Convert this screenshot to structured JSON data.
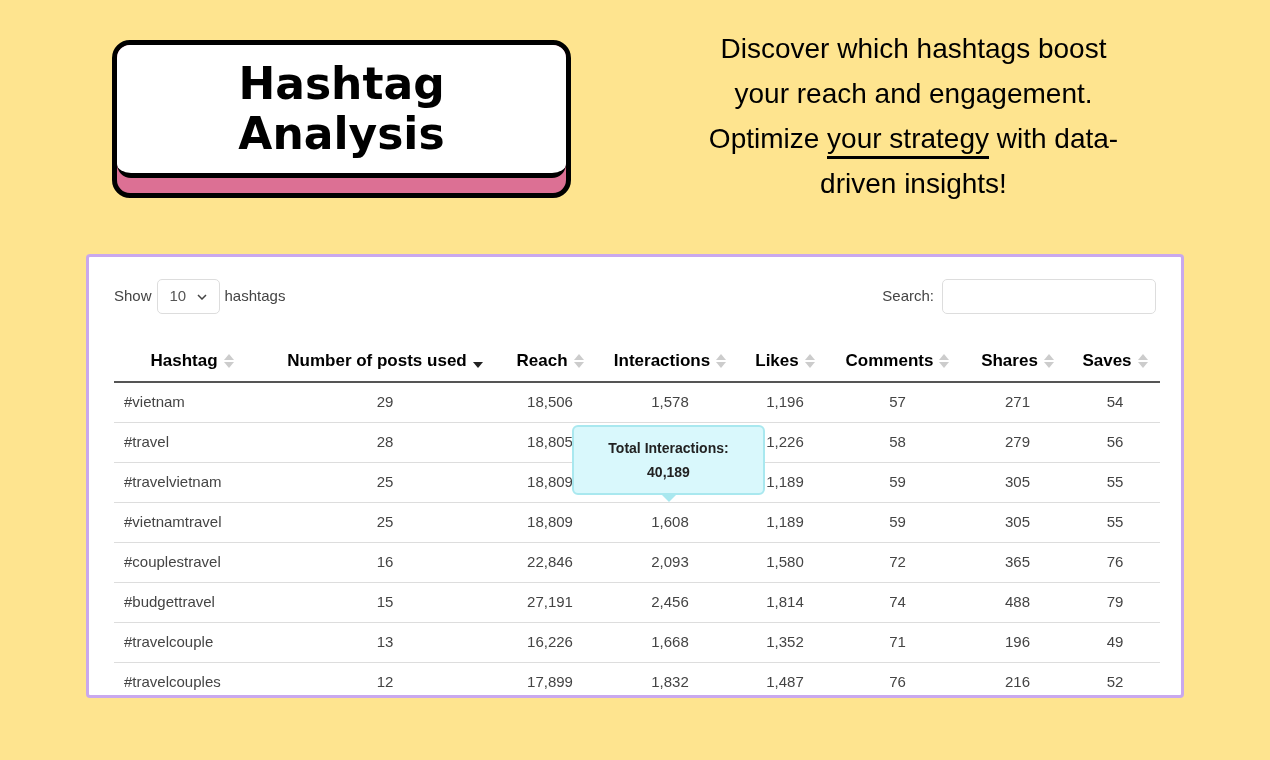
{
  "title": "Hashtag Analysis",
  "tagline": [
    {
      "text": "Discover which hashtags boost your reach and engagement. Optimize ",
      "underlined": false
    },
    {
      "text": "your strategy",
      "underlined": true
    },
    {
      "text": " with data-driven insights!",
      "underlined": false
    }
  ],
  "controls": {
    "show_label": "Show",
    "page_size": "10",
    "show_suffix": "hashtags",
    "search_label": "Search:"
  },
  "table": {
    "columns": [
      {
        "label": "Hashtag",
        "sorted": false
      },
      {
        "label": "Number of posts used",
        "sorted": true
      },
      {
        "label": "Reach",
        "sorted": false
      },
      {
        "label": "Interactions",
        "sorted": false
      },
      {
        "label": "Likes",
        "sorted": false
      },
      {
        "label": "Comments",
        "sorted": false
      },
      {
        "label": "Shares",
        "sorted": false
      },
      {
        "label": "Saves",
        "sorted": false
      }
    ],
    "rows": [
      [
        "#vietnam",
        "29",
        "18,506",
        "1,578",
        "1,196",
        "57",
        "271",
        "54"
      ],
      [
        "#travel",
        "28",
        "18,805",
        null,
        "1,226",
        "58",
        "279",
        "56"
      ],
      [
        "#travelvietnam",
        "25",
        "18,809",
        null,
        "1,189",
        "59",
        "305",
        "55"
      ],
      [
        "#vietnamtravel",
        "25",
        "18,809",
        "1,608",
        "1,189",
        "59",
        "305",
        "55"
      ],
      [
        "#couplestravel",
        "16",
        "22,846",
        "2,093",
        "1,580",
        "72",
        "365",
        "76"
      ],
      [
        "#budgettravel",
        "15",
        "27,191",
        "2,456",
        "1,814",
        "74",
        "488",
        "79"
      ],
      [
        "#travelcouple",
        "13",
        "16,226",
        "1,668",
        "1,352",
        "71",
        "196",
        "49"
      ],
      [
        "#travelcouples",
        "12",
        "17,899",
        "1,832",
        "1,487",
        "76",
        "216",
        "52"
      ]
    ]
  },
  "tooltip": {
    "label": "Total Interactions:",
    "value": "40,189"
  }
}
